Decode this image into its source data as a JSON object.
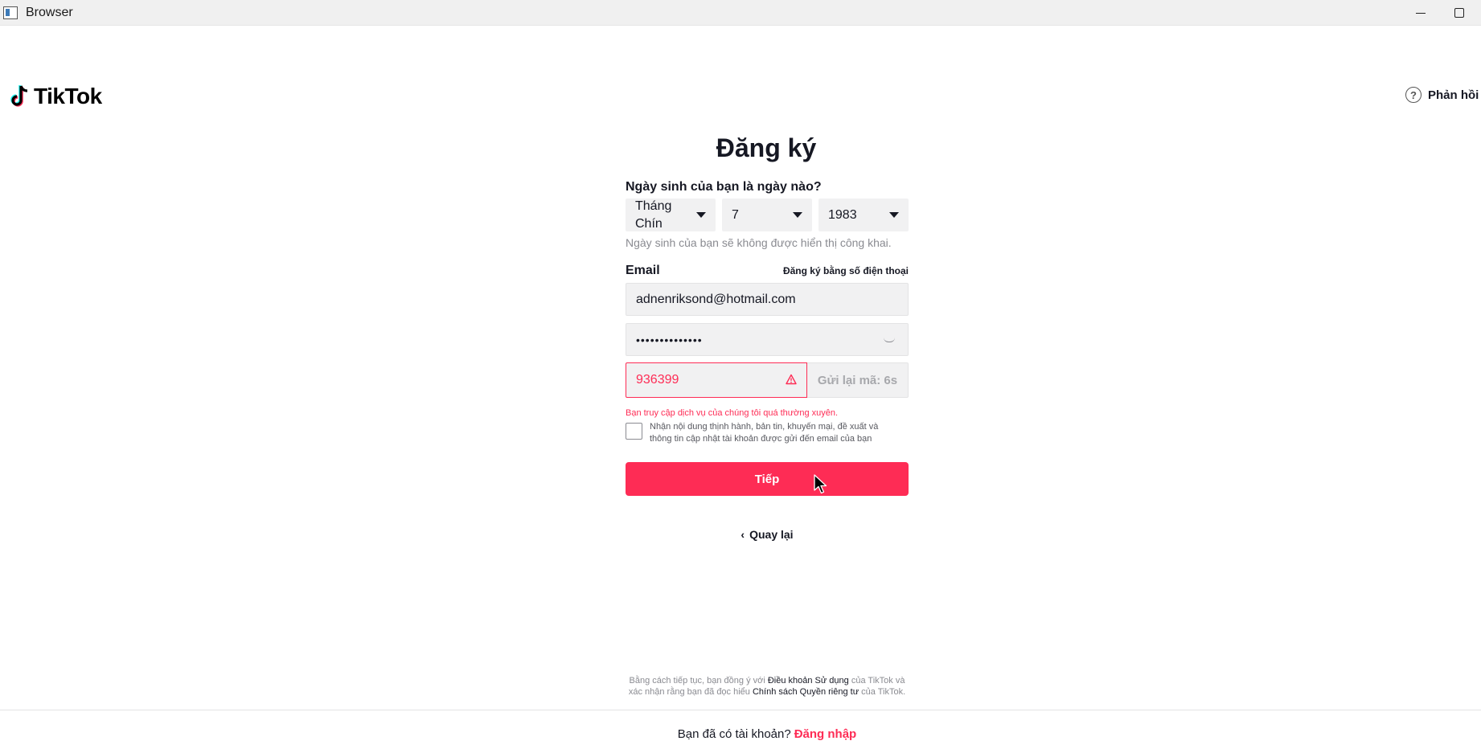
{
  "window": {
    "title": "Browser"
  },
  "header": {
    "logo_text": "TikTok",
    "help_label": "Phản hồi và"
  },
  "form": {
    "title": "Đăng ký",
    "dob_label": "Ngày sinh của bạn là ngày nào?",
    "month_value_line1": "Tháng",
    "month_value_line2": "Chín",
    "day_value": "7",
    "year_value": "1983",
    "dob_hint": "Ngày sinh của bạn sẽ không được hiển thị công khai.",
    "email_label": "Email",
    "phone_signup_link": "Đăng ký bằng số điện thoại",
    "email_value": "adnenriksond@hotmail.com",
    "password_masked": "••••••••••••••",
    "code_value": "936399",
    "resend_label": "Gửi lại mã: 6s",
    "error_message": "Bạn truy cập dịch vụ của chúng tôi quá thường xuyên.",
    "consent_text": "Nhận nội dung thịnh hành, bản tin, khuyến mại, đề xuất và thông tin cập nhật tài khoản được gửi đến email của bạn",
    "consent_checked": false,
    "next_label": "Tiếp",
    "back_label": "Quay lại"
  },
  "footer": {
    "terms_part1": "Bằng cách tiếp tục, bạn đồng ý với ",
    "terms_link": "Điều khoản Sử dụng",
    "terms_part2": " của TikTok và",
    "terms_part3": "xác nhận rằng bạn đã đọc hiểu ",
    "privacy_link": "Chính sách Quyền riêng tư",
    "terms_part4": " của TikTok.",
    "have_account": "Bạn đã có tài khoản?",
    "login_link": "Đăng nhập"
  },
  "colors": {
    "brand_red": "#fe2c55",
    "field_bg": "#f1f1f2"
  }
}
